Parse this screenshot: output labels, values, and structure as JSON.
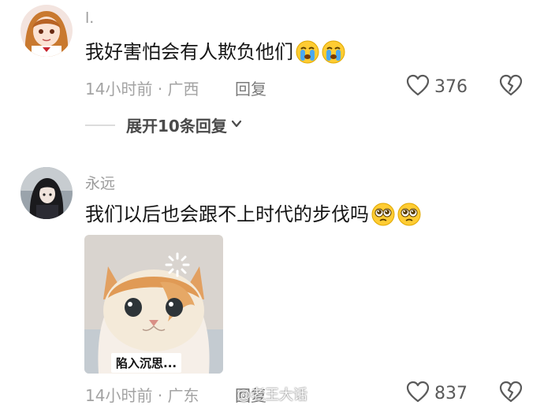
{
  "comments": [
    {
      "username": "l.",
      "text": "我好害怕会有人欺负他们",
      "emojis": [
        "crying-face",
        "crying-face"
      ],
      "time": "14小时前",
      "location": "广西",
      "reply_label": "回复",
      "likes": "376",
      "expand_label": "展开10条回复"
    },
    {
      "username": "永远",
      "text": "我们以后也会跟不上时代的步伐吗",
      "emojis": [
        "pleading-face",
        "pleading-face"
      ],
      "image_caption": "陷入沉思...",
      "time": "14小时前",
      "location": "广东",
      "reply_label": "回复",
      "likes": "837"
    }
  ],
  "watermark": "@老王大话",
  "colors": {
    "text": "#161616",
    "meta": "#a3a3a3",
    "username": "#9c9c9c"
  },
  "icons": [
    "heart-outline-icon",
    "broken-heart-icon",
    "chevron-down-icon"
  ]
}
